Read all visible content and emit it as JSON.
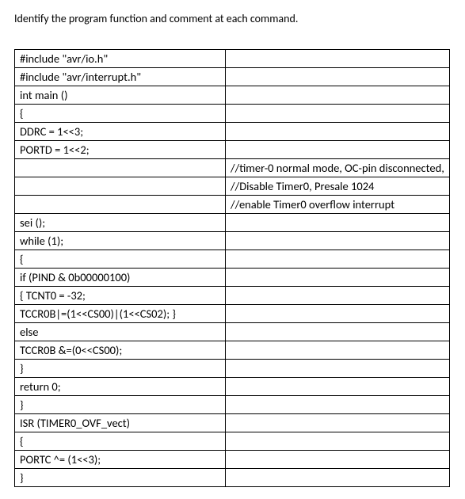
{
  "instruction": "Identify the program function and comment at each command.",
  "rows": [
    {
      "code": "#include \"avr/io.h\"",
      "comment": ""
    },
    {
      "code": "#include \"avr/interrupt.h\"",
      "comment": ""
    },
    {
      "code": "int main ()",
      "comment": ""
    },
    {
      "code": "{",
      "comment": ""
    },
    {
      "code": "DDRC = 1<<3;",
      "comment": ""
    },
    {
      "code": "PORTD = 1<<2;",
      "comment": ""
    },
    {
      "code": "",
      "comment": "//timer-0 normal mode, OC-pin disconnected,"
    },
    {
      "code": "",
      "comment": "//Disable Timer0, Presale 1024"
    },
    {
      "code": "",
      "comment": "//enable Timer0 overflow interrupt"
    },
    {
      "code": "sei ();",
      "comment": ""
    },
    {
      "code": "while (1);",
      "comment": ""
    },
    {
      "code": "{",
      "comment": ""
    },
    {
      "code": "if (PIND & 0b00000100)",
      "comment": ""
    },
    {
      "code": "{  TCNT0 = -32;",
      "comment": ""
    },
    {
      "code": "TCCR0B|=(1<<CS00)|(1<<CS02); }",
      "comment": ""
    },
    {
      "code": "else",
      "comment": ""
    },
    {
      "code": "TCCR0B      &=(0<<CS00);",
      "comment": ""
    },
    {
      "code": "}",
      "comment": ""
    },
    {
      "code": "return 0;",
      "comment": ""
    },
    {
      "code": "}",
      "comment": ""
    },
    {
      "code": "ISR (TIMER0_OVF_vect)",
      "comment": ""
    },
    {
      "code": "{",
      "comment": ""
    },
    {
      "code": "PORTC ^= (1<<3);",
      "comment": ""
    },
    {
      "code": "}",
      "comment": ""
    }
  ]
}
